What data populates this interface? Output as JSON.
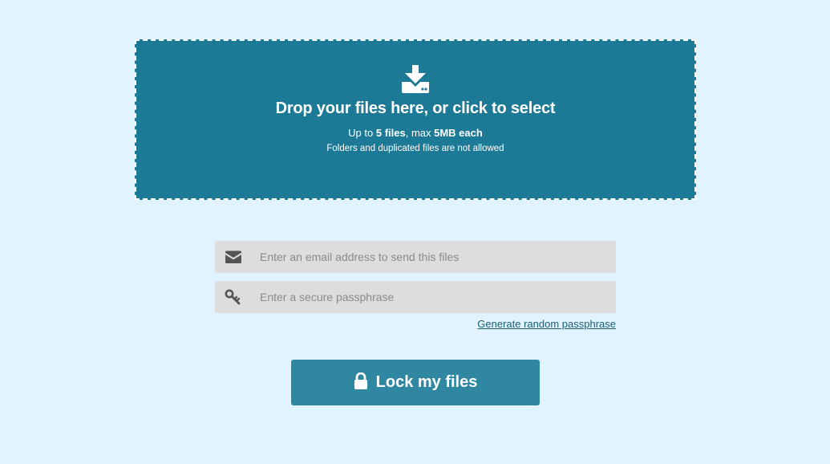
{
  "dropzone": {
    "icon": "download-tray-icon",
    "title": "Drop your files here, or click to select",
    "limits": {
      "prefix": "Up to ",
      "files": "5 files",
      "middle": ", max ",
      "size": "5MB each"
    },
    "note": "Folders and duplicated files are not allowed"
  },
  "form": {
    "email": {
      "icon": "envelope-icon",
      "placeholder": "Enter an email address to send this files",
      "value": ""
    },
    "passphrase": {
      "icon": "key-icon",
      "placeholder": "Enter a secure passphrase",
      "value": ""
    },
    "generate_link": "Generate random passphrase"
  },
  "submit": {
    "icon": "lock-icon",
    "label": "Lock my files"
  },
  "colors": {
    "background": "#e1f3ff",
    "dropzone": "#1d7a96",
    "button": "#2f87a1",
    "field": "#dddddd",
    "link": "#1a5f73"
  }
}
